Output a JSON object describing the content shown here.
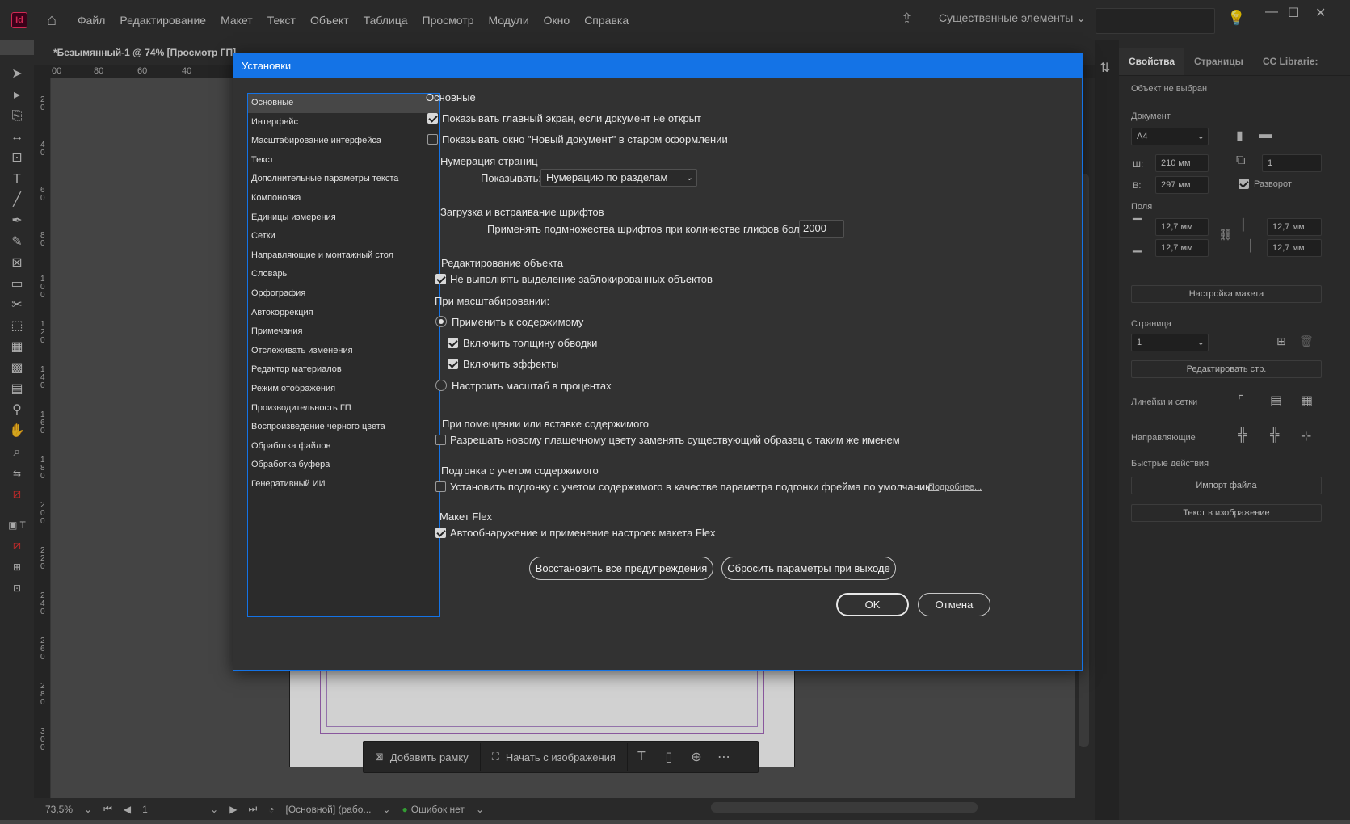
{
  "app": {
    "logo_text": "Id",
    "menu": [
      "Файл",
      "Редактирование",
      "Макет",
      "Текст",
      "Объект",
      "Таблица",
      "Просмотр",
      "Модули",
      "Окно",
      "Справка"
    ],
    "workspace": "Существенные элементы",
    "document_tab": "*Безымянный-1 @ 74% [Просмотр ГП]"
  },
  "ruler": {
    "h_labels": [
      "00",
      "80",
      "60",
      "40"
    ],
    "v_labels": [
      "20",
      "40",
      "60",
      "80",
      "100",
      "120",
      "140",
      "160",
      "180",
      "200",
      "220",
      "240",
      "260",
      "280",
      "300"
    ]
  },
  "context_bar": {
    "add_frame": "Добавить рамку",
    "start_from_image": "Начать с изображения"
  },
  "status_bar": {
    "zoom": "73,5%",
    "page": "1",
    "profile": "[Основной] (рабо...",
    "errors": "Ошибок нет"
  },
  "properties_panel": {
    "tabs": [
      "Свойства",
      "Страницы",
      "CC Librarie:"
    ],
    "no_selection": "Объект не выбран",
    "document_label": "Документ",
    "page_size": "A4",
    "width_label": "Ш:",
    "width": "210 мм",
    "height_label": "В:",
    "height": "297 мм",
    "pages_count": "1",
    "spread_label": "Разворот",
    "margins_label": "Поля",
    "margin_top": "12,7 мм",
    "margin_bottom": "12,7 мм",
    "margin_left": "12,7 мм",
    "margin_right": "12,7 мм",
    "layout_setup_button": "Настройка макета",
    "page_label": "Страница",
    "page_value": "1",
    "edit_page_button": "Редактировать стр.",
    "rulers_grids_label": "Линейки и сетки",
    "guides_label": "Направляющие",
    "quick_actions_label": "Быстрые действия",
    "import_file_button": "Импорт файла",
    "text_in_image_button": "Текст в изображение"
  },
  "dialog": {
    "title": "Установки",
    "categories": [
      "Основные",
      "Интерфейс",
      "Масштабирование интерфейса",
      "Текст",
      "Дополнительные параметры текста",
      "Компоновка",
      "Единицы измерения",
      "Сетки",
      "Направляющие и монтажный стол",
      "Словарь",
      "Орфография",
      "Автокоррекция",
      "Примечания",
      "Отслеживать изменения",
      "Редактор материалов",
      "Режим отображения",
      "Производительность ГП",
      "Воспроизведение черного цвета",
      "Обработка файлов",
      "Обработка буфера",
      "Генеративный ИИ"
    ],
    "section_title": "Основные",
    "show_home": "Показывать главный экран, если документ не открыт",
    "show_legacy_new_doc": "Показывать окно \"Новый документ\" в старом оформлении",
    "page_numbering_title": "Нумерация страниц",
    "show_label": "Показывать:",
    "show_value": "Нумерацию по разделам",
    "fonts_title": "Загрузка и встраивание шрифтов",
    "subset_label": "Применять подмножества шрифтов при количестве глифов более:",
    "subset_value": "2000",
    "object_editing_title": "Редактирование объекта",
    "no_select_locked": "Не выполнять выделение заблокированных объектов",
    "when_scaling": "При масштабировании:",
    "apply_to_content": "Применить к содержимому",
    "include_stroke": "Включить толщину обводки",
    "include_effects": "Включить эффекты",
    "adjust_percent": "Настроить масштаб в процентах",
    "paste_title": "При помещении или вставке содержимого",
    "allow_swatch_replace": "Разрешать новому плашечному цвету заменять существующий образец с таким же именем",
    "content_aware_title": "Подгонка с учетом содержимого",
    "content_aware_default": "Установить подгонку с учетом содержимого в качестве параметра подгонки фрейма по умолчанию",
    "learn_more": "Подробнее...",
    "flex_title": "Макет Flex",
    "flex_auto": "Автообнаружение и применение настроек макета Flex",
    "reset_warnings": "Восстановить все предупреждения",
    "reset_prefs": "Сбросить параметры при выходе",
    "ok": "OK",
    "cancel": "Отмена"
  },
  "colors": {
    "accent": "#1473e6",
    "dialog_bg": "#323232",
    "ui_bg": "#535353"
  }
}
